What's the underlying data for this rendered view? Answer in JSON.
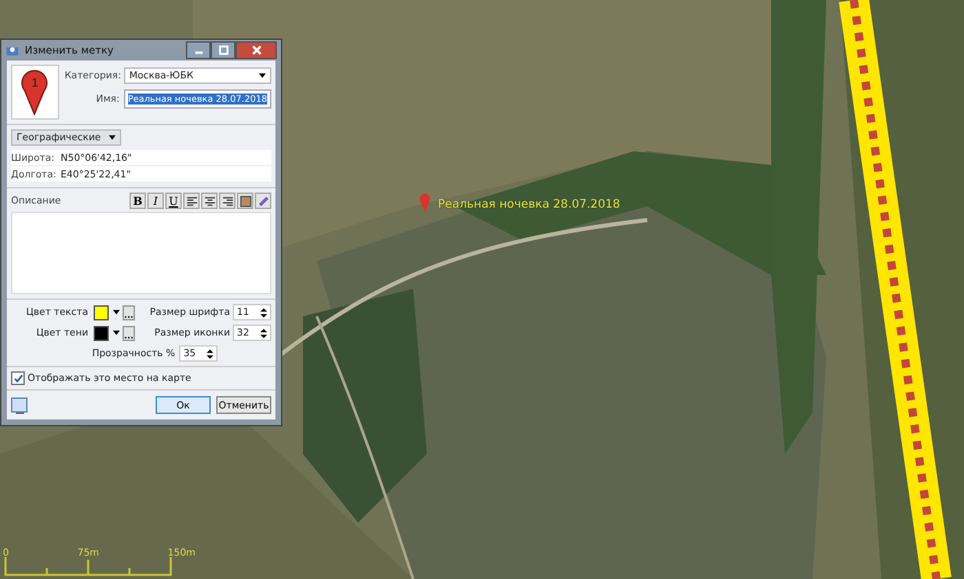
{
  "window": {
    "title": "Изменить метку"
  },
  "placemark_icon": {
    "number": "1"
  },
  "category": {
    "label": "Категория:",
    "value": "Москва-ЮБК"
  },
  "name": {
    "label": "Имя:",
    "value": "Реальная ночевка 28.07.2018",
    "selected": true
  },
  "coord_format": {
    "value": "Географические"
  },
  "coords": [
    {
      "label": "Широта:",
      "value": "N50°06'42,16\""
    },
    {
      "label": "Долгота:",
      "value": "E40°25'22,41\""
    }
  ],
  "description": {
    "label": "Описание"
  },
  "format_buttons": [
    {
      "kind": "bold",
      "label": "B"
    },
    {
      "kind": "italic",
      "label": "I"
    },
    {
      "kind": "underline",
      "label": "U"
    }
  ],
  "colors": [
    {
      "label": "Цвет текста",
      "color": "#ffff00"
    },
    {
      "label": "Цвет тени",
      "color": "#000000"
    }
  ],
  "sizes": [
    {
      "label": "Размер шрифта",
      "value": "11"
    },
    {
      "label": "Размер иконки",
      "value": "32"
    }
  ],
  "transparency": {
    "label": "Прозрачность %",
    "value": "35"
  },
  "show_on_map": {
    "label": "Отображать это место на карте",
    "checked": true
  },
  "buttons": [
    {
      "label": "Ок",
      "kind": "default"
    },
    {
      "label": "Отменить",
      "kind": "normal"
    }
  ],
  "map": {
    "placemark_label": "Реальная ночевка 28.07.2018",
    "scale": [
      "0",
      "75m",
      "150m"
    ]
  }
}
